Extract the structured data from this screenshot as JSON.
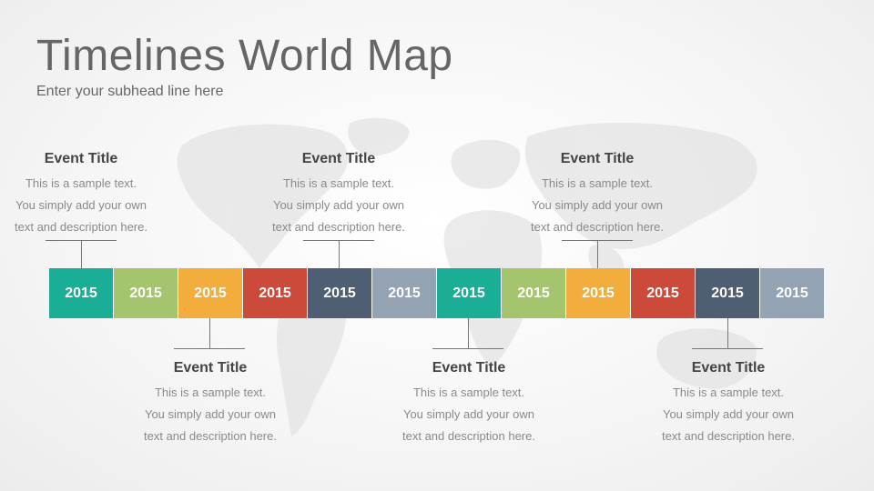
{
  "header": {
    "title": "Timelines World Map",
    "subtitle": "Enter your subhead line here"
  },
  "timeline": {
    "segments": [
      {
        "label": "2015",
        "color": "#1aae96"
      },
      {
        "label": "2015",
        "color": "#a5c46e"
      },
      {
        "label": "2015",
        "color": "#f3ad3c"
      },
      {
        "label": "2015",
        "color": "#cc4a3a"
      },
      {
        "label": "2015",
        "color": "#4e5e73"
      },
      {
        "label": "2015",
        "color": "#94a3b3"
      },
      {
        "label": "2015",
        "color": "#1aae96"
      },
      {
        "label": "2015",
        "color": "#a5c46e"
      },
      {
        "label": "2015",
        "color": "#f3ad3c"
      },
      {
        "label": "2015",
        "color": "#cc4a3a"
      },
      {
        "label": "2015",
        "color": "#4e5e73"
      },
      {
        "label": "2015",
        "color": "#94a3b3"
      }
    ]
  },
  "events": [
    {
      "title": "Event Title",
      "line1": "This is a sample text.",
      "line2": "You simply add your own",
      "line3": "text and description here."
    },
    {
      "title": "Event Title",
      "line1": "This is a sample text.",
      "line2": "You simply add your own",
      "line3": "text and description here."
    },
    {
      "title": "Event Title",
      "line1": "This is a sample text.",
      "line2": "You simply add your own",
      "line3": "text and description here."
    },
    {
      "title": "Event Title",
      "line1": "This is a sample text.",
      "line2": "You simply add your own",
      "line3": "text and description here."
    },
    {
      "title": "Event Title",
      "line1": "This is a sample text.",
      "line2": "You simply add your own",
      "line3": "text and description here."
    },
    {
      "title": "Event Title",
      "line1": "This is a sample text.",
      "line2": "You simply add your own",
      "line3": "text and description here."
    }
  ]
}
